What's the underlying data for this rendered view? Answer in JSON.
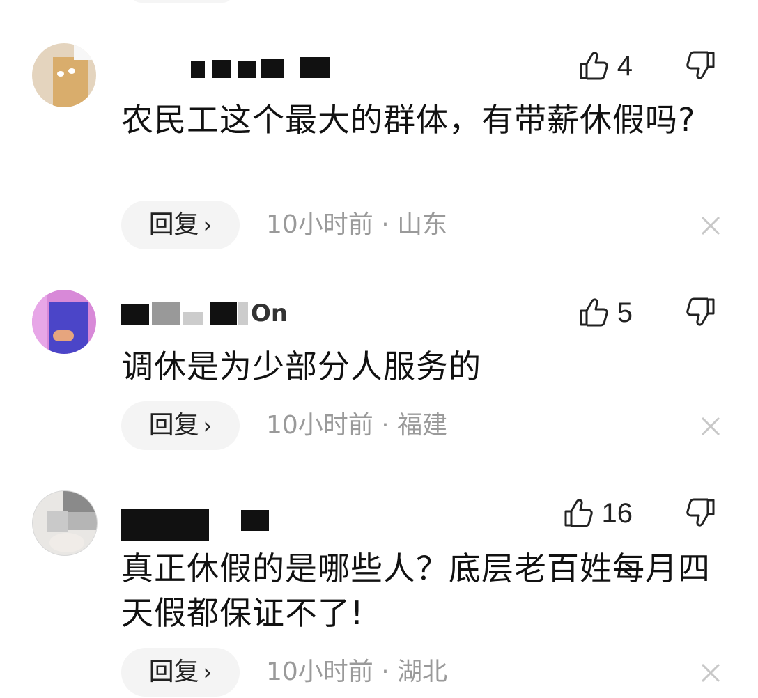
{
  "comments": [
    {
      "username": "",
      "likes": "4",
      "content": "农民工这个最大的群体，有带薪休假吗?",
      "reply_label": "回复",
      "time": "10小时前",
      "separator": "·",
      "location": "山东"
    },
    {
      "username": "On",
      "likes": "5",
      "content": "调休是为少部分人服务的",
      "reply_label": "回复",
      "time": "10小时前",
      "separator": "·",
      "location": "福建"
    },
    {
      "username": "",
      "likes": "16",
      "content": "真正休假的是哪些人？底层老百姓每月四天假都保证不了!",
      "reply_label": "回复",
      "time": "10小时前",
      "separator": "·",
      "location": "湖北"
    }
  ],
  "icons": {
    "like": "thumbs-up-icon",
    "dislike": "thumbs-down-icon",
    "close": "close-icon",
    "chevron": "chevron-right-icon"
  },
  "colors": {
    "text": "#111111",
    "meta": "#9a9a9a",
    "button_bg": "#f4f4f4",
    "close": "#c8c8c8"
  }
}
